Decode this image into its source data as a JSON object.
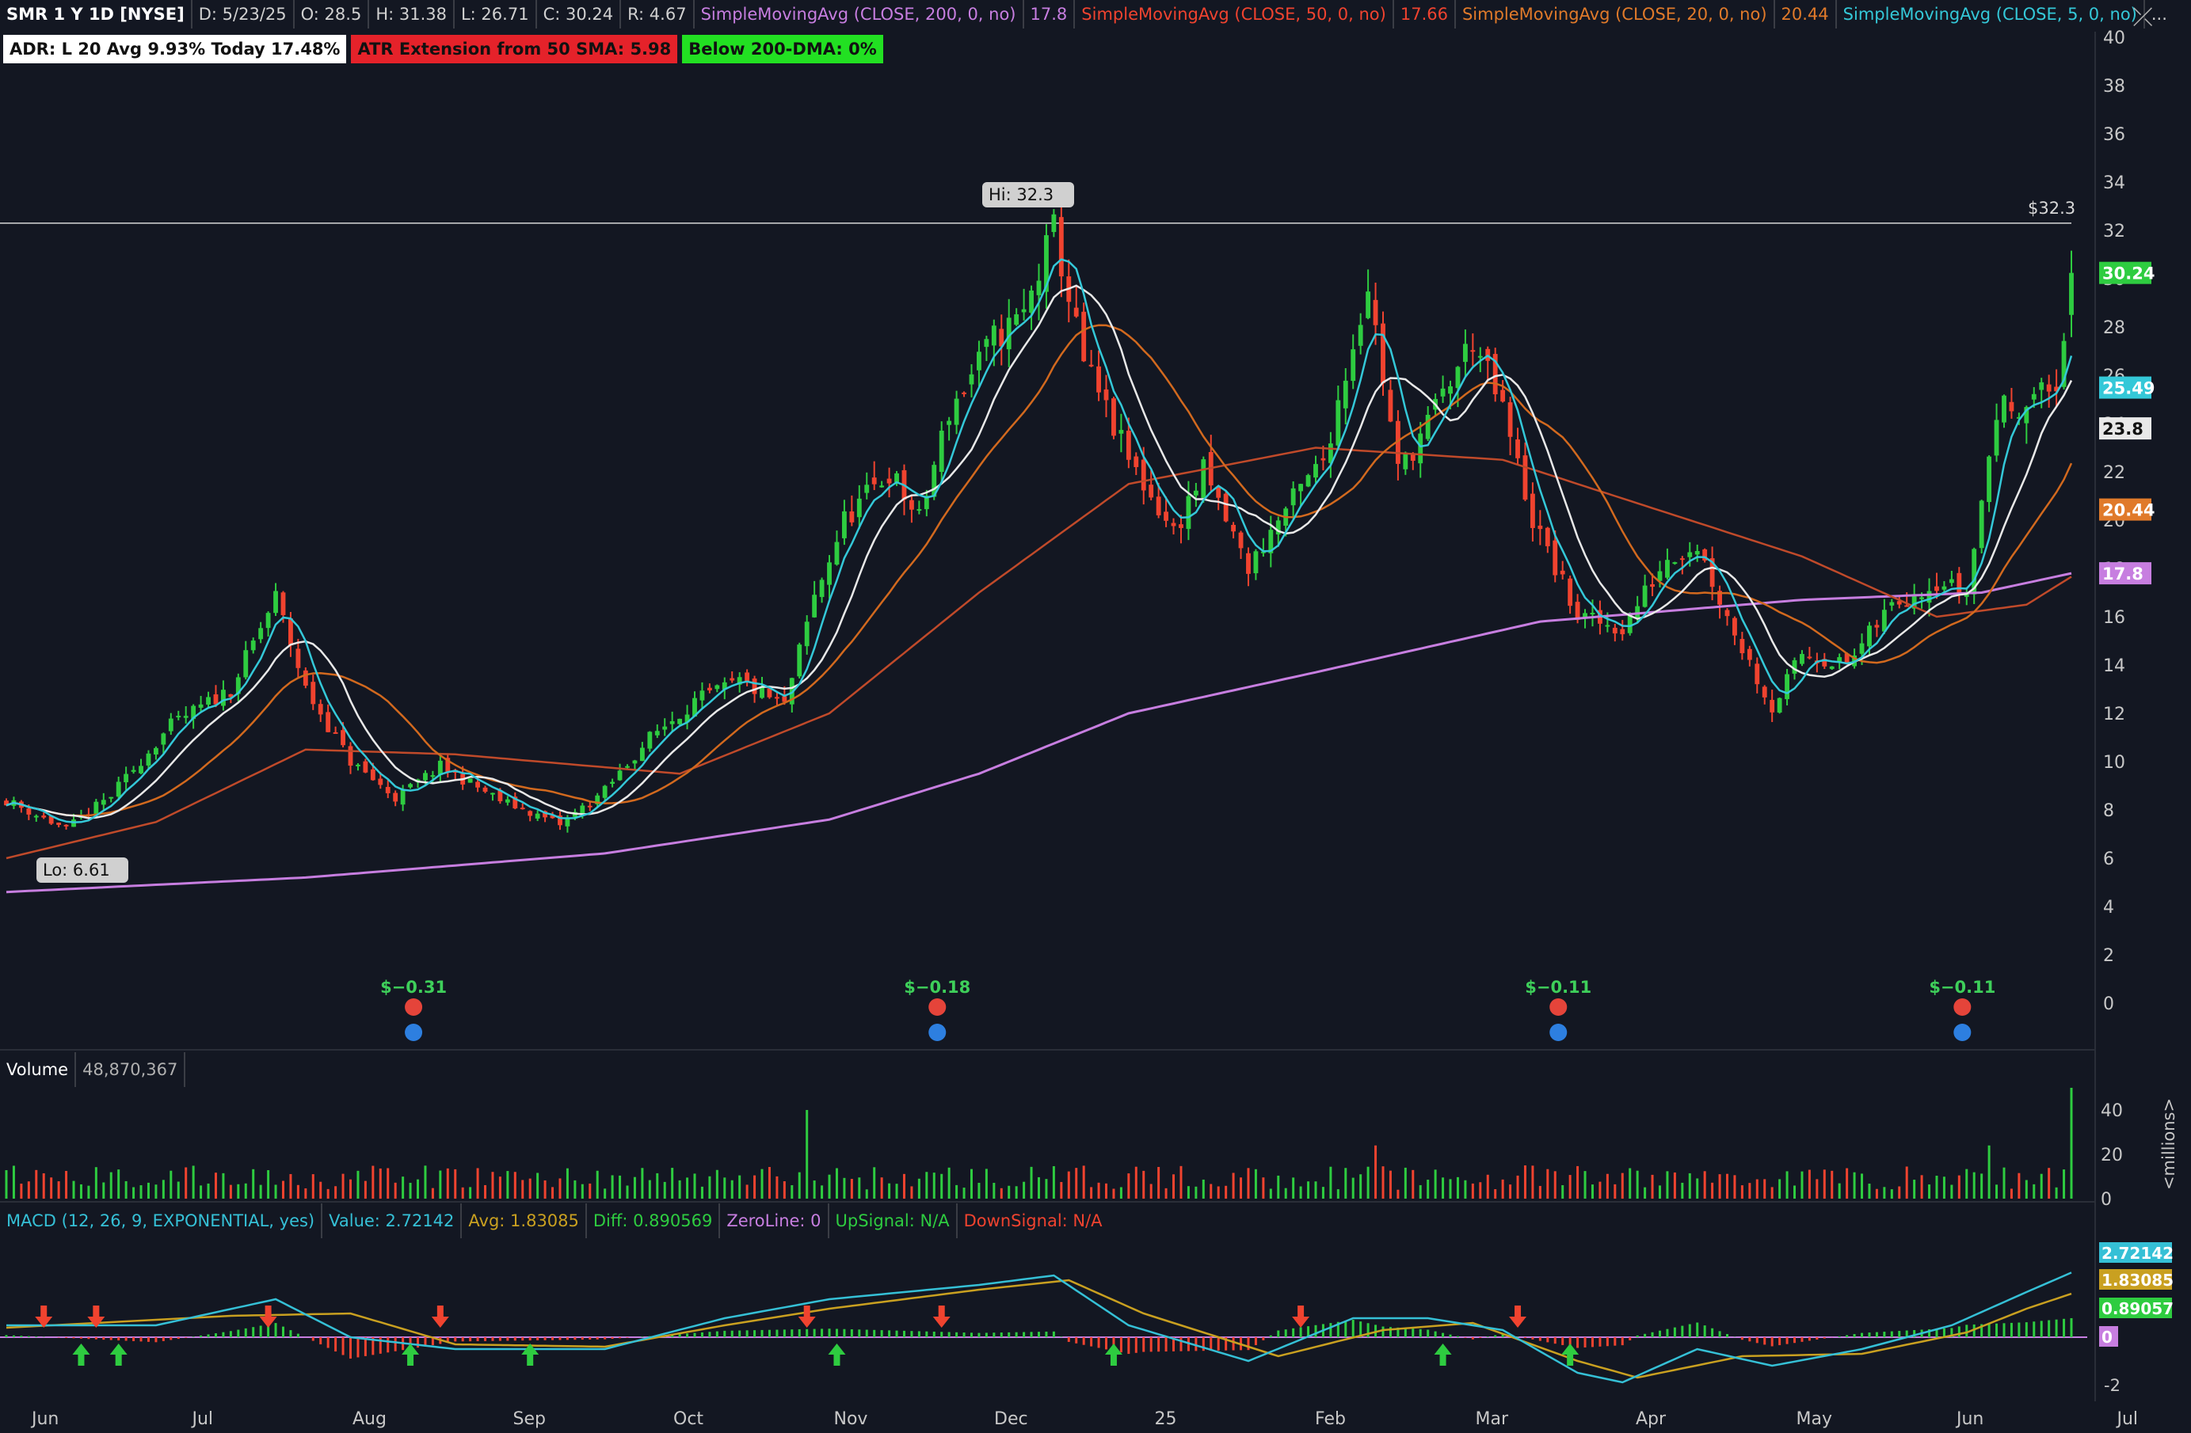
{
  "header": {
    "symbol": "SMR 1 Y 1D [NYSE]",
    "date": "D: 5/23/25",
    "open": "O: 28.5",
    "high": "H: 31.38",
    "low": "L: 26.71",
    "close": "C: 30.24",
    "range": "R: 4.67",
    "sma200_label": "SimpleMovingAvg (CLOSE, 200, 0, no)",
    "sma200_value": "17.8",
    "sma50_label": "SimpleMovingAvg (CLOSE, 50, 0, no)",
    "sma50_value": "17.66",
    "sma20_label": "SimpleMovingAvg (CLOSE, 20, 0, no)",
    "sma20_value": "20.44",
    "sma5_label": "SimpleMovingAvg (CLOSE, 5, 0, no)",
    "more": "..."
  },
  "badges": {
    "adr": "ADR: L 20  Avg 9.93%  Today 17.48%",
    "atr": "ATR Extension from 50 SMA: 5.98",
    "dma": "Below 200-DMA: 0%"
  },
  "volume_bar": {
    "label": "Volume",
    "value": "48,870,367"
  },
  "macd_bar": {
    "label": "MACD (12, 26, 9, EXPONENTIAL, yes)",
    "value": "Value: 2.72142",
    "avg": "Avg: 1.83085",
    "diff": "Diff: 0.890569",
    "zero": "ZeroLine: 0",
    "up": "UpSignal: N/A",
    "down": "DownSignal: N/A"
  },
  "colors": {
    "up": "#2ecc40",
    "down": "#f0432f",
    "sma5": "#34c8d8",
    "sma20": "#d2691e",
    "sma50": "#c04a2a",
    "sma200": "#c77ee0",
    "white": "#e8e8e8",
    "macd": "#35c0d6",
    "avg": "#c9a020"
  },
  "chart_data": [
    {
      "type": "candlestick",
      "title": "SMR 1 Y 1D [NYSE]",
      "ylim": [
        0,
        40
      ],
      "y_ticks": [
        0,
        2,
        4,
        6,
        8,
        10,
        12,
        14,
        16,
        18,
        20,
        22,
        24,
        26,
        28,
        30,
        32,
        34,
        36,
        38,
        40
      ],
      "x_ticks": [
        "Jun",
        "Jul",
        "Aug",
        "Sep",
        "Oct",
        "Nov",
        "Dec",
        "25",
        "Feb",
        "Mar",
        "Apr",
        "May",
        "Jun",
        "Jul"
      ],
      "price_path": [
        [
          0,
          8.4
        ],
        [
          8,
          7.2
        ],
        [
          14,
          8.6
        ],
        [
          22,
          11.5
        ],
        [
          30,
          13.0
        ],
        [
          36,
          16.8
        ],
        [
          40,
          13.0
        ],
        [
          46,
          10.0
        ],
        [
          52,
          8.5
        ],
        [
          58,
          9.8
        ],
        [
          66,
          8.4
        ],
        [
          74,
          7.4
        ],
        [
          80,
          8.8
        ],
        [
          86,
          11.0
        ],
        [
          92,
          12.5
        ],
        [
          98,
          13.3
        ],
        [
          104,
          12.3
        ],
        [
          108,
          16.8
        ],
        [
          112,
          20.0
        ],
        [
          118,
          22.0
        ],
        [
          122,
          20.0
        ],
        [
          126,
          24.5
        ],
        [
          132,
          27.5
        ],
        [
          136,
          28.5
        ],
        [
          140,
          32.0
        ],
        [
          144,
          26.5
        ],
        [
          150,
          22.5
        ],
        [
          156,
          19.5
        ],
        [
          160,
          22.0
        ],
        [
          166,
          18.0
        ],
        [
          170,
          20.0
        ],
        [
          176,
          22.5
        ],
        [
          182,
          29.8
        ],
        [
          186,
          22.0
        ],
        [
          190,
          24.0
        ],
        [
          196,
          27.5
        ],
        [
          200,
          24.5
        ],
        [
          204,
          20.0
        ],
        [
          210,
          16.0
        ],
        [
          216,
          15.5
        ],
        [
          222,
          18.5
        ],
        [
          226,
          19.0
        ],
        [
          230,
          16.0
        ],
        [
          236,
          12.2
        ],
        [
          240,
          14.5
        ],
        [
          246,
          14.0
        ],
        [
          252,
          16.5
        ],
        [
          258,
          17.5
        ],
        [
          262,
          17.0
        ],
        [
          266,
          24.5
        ],
        [
          270,
          25.0
        ],
        [
          274,
          25.5
        ],
        [
          276,
          30.24
        ]
      ],
      "hi_label": "Hi: 32.3",
      "lo_label": "Lo: 6.61",
      "hi_price": 32.3,
      "hi_line_label": "$32.3",
      "last_close": 30.24,
      "sma200_path": [
        [
          0,
          4.6
        ],
        [
          40,
          5.2
        ],
        [
          80,
          6.2
        ],
        [
          110,
          7.6
        ],
        [
          130,
          9.5
        ],
        [
          150,
          12.0
        ],
        [
          175,
          13.7
        ],
        [
          205,
          15.8
        ],
        [
          240,
          16.7
        ],
        [
          264,
          17.0
        ],
        [
          276,
          17.8
        ]
      ],
      "sma50_path": [
        [
          0,
          6.0
        ],
        [
          20,
          7.5
        ],
        [
          40,
          10.5
        ],
        [
          60,
          10.3
        ],
        [
          90,
          9.5
        ],
        [
          110,
          12.0
        ],
        [
          130,
          17.0
        ],
        [
          150,
          21.5
        ],
        [
          175,
          23.0
        ],
        [
          200,
          22.5
        ],
        [
          215,
          21.0
        ],
        [
          240,
          18.5
        ],
        [
          258,
          16.0
        ],
        [
          270,
          16.5
        ],
        [
          276,
          17.66
        ]
      ],
      "price_labels": [
        {
          "value": 30.24,
          "text": "30.24",
          "series": "last"
        },
        {
          "value": 25.49,
          "text": "25.49",
          "series": "sma5"
        },
        {
          "value": 23.8,
          "text": "23.8",
          "series": "white"
        },
        {
          "value": 20.44,
          "text": "20.44",
          "series": "sma20"
        },
        {
          "value": 17.8,
          "text": "17.8",
          "series": "sma200"
        }
      ],
      "earnings": [
        {
          "x": 54,
          "text": "$−0.31"
        },
        {
          "x": 124,
          "text": "$−0.18"
        },
        {
          "x": 207,
          "text": "$−0.11"
        },
        {
          "x": 261,
          "text": "$−0.11"
        }
      ]
    },
    {
      "type": "bar",
      "title": "Volume",
      "ylim": [
        0,
        50
      ],
      "y_ticks": [
        0,
        20,
        40
      ],
      "ylabel": "<millions>",
      "spikes": [
        [
          107,
          40
        ],
        [
          126,
          14
        ],
        [
          183,
          24
        ],
        [
          265,
          24
        ],
        [
          276,
          50
        ]
      ],
      "last_value": 48870367
    },
    {
      "type": "line",
      "title": "MACD (12, 26, 9, EXPONENTIAL, yes)",
      "ylim": [
        -2,
        3
      ],
      "y_ticks": [
        0,
        -2
      ],
      "series": [
        {
          "name": "Value",
          "values": [
            [
              0,
              0.5
            ],
            [
              20,
              0.5
            ],
            [
              36,
              1.6
            ],
            [
              46,
              0.0
            ],
            [
              60,
              -0.5
            ],
            [
              80,
              -0.5
            ],
            [
              96,
              0.8
            ],
            [
              110,
              1.6
            ],
            [
              130,
              2.2
            ],
            [
              140,
              2.6
            ],
            [
              150,
              0.5
            ],
            [
              166,
              -1.0
            ],
            [
              180,
              0.8
            ],
            [
              190,
              0.8
            ],
            [
              200,
              0.3
            ],
            [
              210,
              -1.5
            ],
            [
              216,
              -1.9
            ],
            [
              226,
              -0.5
            ],
            [
              236,
              -1.2
            ],
            [
              248,
              -0.5
            ],
            [
              260,
              0.5
            ],
            [
              270,
              1.9
            ],
            [
              276,
              2.72142
            ]
          ]
        },
        {
          "name": "Avg",
          "values": [
            [
              0,
              0.4
            ],
            [
              30,
              0.9
            ],
            [
              46,
              1.0
            ],
            [
              60,
              -0.3
            ],
            [
              80,
              -0.4
            ],
            [
              96,
              0.5
            ],
            [
              110,
              1.2
            ],
            [
              130,
              2.0
            ],
            [
              142,
              2.4
            ],
            [
              152,
              1.0
            ],
            [
              170,
              -0.8
            ],
            [
              184,
              0.3
            ],
            [
              196,
              0.6
            ],
            [
              210,
              -1.0
            ],
            [
              218,
              -1.7
            ],
            [
              232,
              -0.8
            ],
            [
              248,
              -0.7
            ],
            [
              262,
              0.2
            ],
            [
              270,
              1.2
            ],
            [
              276,
              1.83085
            ]
          ]
        }
      ],
      "diff_value": 0.890569,
      "labels": [
        {
          "value": 2.72142,
          "text": "2.72142",
          "series": "macd"
        },
        {
          "value": 1.83085,
          "text": "1.83085",
          "series": "avg"
        },
        {
          "value": 0.89057,
          "text": "0.89057",
          "series": "diff"
        },
        {
          "value": 0,
          "text": "0",
          "series": "zero"
        }
      ],
      "down_arrows": [
        5,
        12,
        35,
        58,
        107,
        125,
        173,
        202
      ],
      "up_arrows": [
        10,
        15,
        54,
        70,
        111,
        148,
        192,
        209
      ]
    }
  ]
}
